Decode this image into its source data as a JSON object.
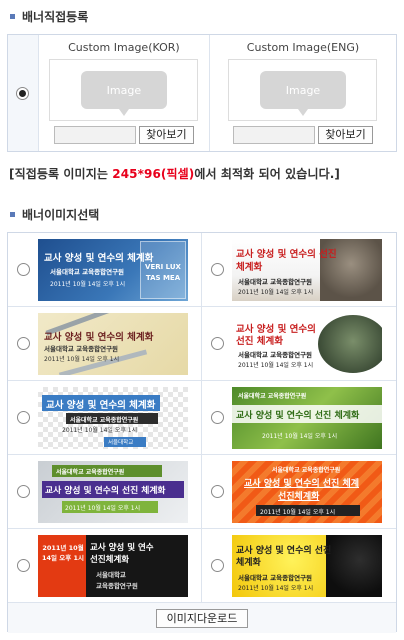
{
  "direct": {
    "section_title": "배너직접등록",
    "kor": {
      "caption": "Custom Image(KOR)",
      "image_placeholder": "Image",
      "browse_label": "찾아보기"
    },
    "eng": {
      "caption": "Custom Image(ENG)",
      "image_placeholder": "Image",
      "browse_label": "찾아보기"
    },
    "selected": true
  },
  "notice": {
    "prefix": "[직접등록 이미지는 ",
    "size": "245*96(픽셀)",
    "suffix": "에서 최적화 되어 있습니다.]"
  },
  "select": {
    "section_title": "배너이미지선택",
    "banners": [
      {
        "title": "교사 양성 및 연수의 체계화",
        "org": "서울대학교 교육종합연구원",
        "date": "2011년 10월 14일 오후 1시",
        "stamp": "VERI LUX TAS MEA"
      },
      {
        "title": "교사 양성 및 연수의 선진",
        "title2": "체계화",
        "org": "서울대학교 교육종합연구원",
        "date": "2011년 10월 14일 오후 1시"
      },
      {
        "title": "교사 양성 및 연수의 체계화",
        "org": "서울대학교 교육종합연구원",
        "date": "2011년 10월 14일 오후 1시"
      },
      {
        "title": "교사 양성 및 연수의",
        "title2": "선진 체계화",
        "org": "서울대학교 교육종합연구원",
        "date": "2011년 10월 14일 오후 1시"
      },
      {
        "title": "교사 양성 및 연수의 체계화",
        "org": "서울대학교 교육종합연구원",
        "date": "2011년 10월 14일 오후 1시",
        "date2": "서울대학교"
      },
      {
        "title": "교사 양성 및 연수의 선진 체계화",
        "org": "서울대학교 교육종합연구원",
        "date": "2011년 10월 14일 오후 1시"
      },
      {
        "title": "교사 양성 및 연수의 선진 체계화",
        "org": "서울대학교 교육종합연구원",
        "date": "2011년 10월 14일 오후 1시"
      },
      {
        "title": "교사 양성 및 연수의 선진 체계",
        "title2": "선진체계화",
        "org": "서울대학교 교육종합연구원",
        "date": "2011년 10월 14일 오후 1시"
      },
      {
        "side": "2011년 10월 14일 오후 1시",
        "title": "교사 양성 및 연수",
        "title2": "선진체계화",
        "org": "서울대학교",
        "org2": "교육종합연구원"
      },
      {
        "title": "교사 양성 및 연수의 선진",
        "title2": "체계화",
        "org": "서울대학교 교육종합연구원",
        "date": "2011년 10월 14일 오후 1시"
      }
    ],
    "download_label": "이미지다운로드"
  },
  "colors": {
    "accent_red": "#e8001c",
    "bullet": "#5a7ab8",
    "border": "#cfd8e6"
  }
}
